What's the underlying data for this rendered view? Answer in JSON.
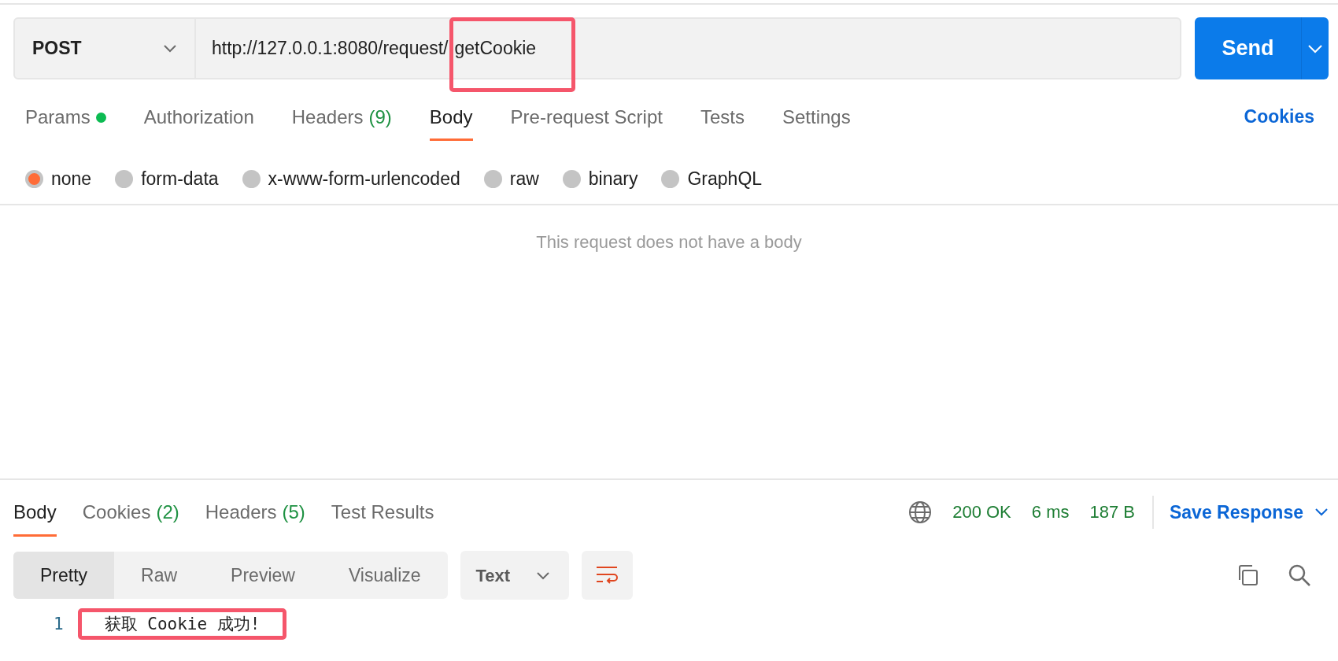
{
  "request": {
    "method": "POST",
    "url_parts": [
      {
        "text": "http://127.0.0.1:8080/request/",
        "highlighted": false
      },
      {
        "text": "getCookie",
        "highlighted": true
      }
    ],
    "send": "Send"
  },
  "request_tabs": [
    {
      "label": "Params",
      "dot": true,
      "selected": false
    },
    {
      "label": "Authorization",
      "selected": false
    },
    {
      "label": "Headers",
      "count": "(9)",
      "selected": false
    },
    {
      "label": "Body",
      "selected": true
    },
    {
      "label": "Pre-request Script",
      "selected": false
    },
    {
      "label": "Tests",
      "selected": false
    },
    {
      "label": "Settings",
      "selected": false
    }
  ],
  "cookies_link": "Cookies",
  "body_types": [
    {
      "label": "none",
      "selected": true
    },
    {
      "label": "form-data",
      "selected": false
    },
    {
      "label": "x-www-form-urlencoded",
      "selected": false
    },
    {
      "label": "raw",
      "selected": false
    },
    {
      "label": "binary",
      "selected": false
    },
    {
      "label": "GraphQL",
      "selected": false
    }
  ],
  "empty_message": "This request does not have a body",
  "response_tabs": [
    {
      "label": "Body",
      "selected": true
    },
    {
      "label": "Cookies",
      "count": "(2)",
      "selected": false
    },
    {
      "label": "Headers",
      "count": "(5)",
      "selected": false
    },
    {
      "label": "Test Results",
      "selected": false
    }
  ],
  "status": {
    "code": "200 OK",
    "time": "6 ms",
    "size": "187 B",
    "save": "Save Response"
  },
  "view_modes": [
    {
      "label": "Pretty",
      "selected": true
    },
    {
      "label": "Raw",
      "selected": false
    },
    {
      "label": "Preview",
      "selected": false
    },
    {
      "label": "Visualize",
      "selected": false
    }
  ],
  "format": "Text",
  "lines": [
    {
      "number": "1",
      "parts": [
        {
          "text": "获取 Cookie 成功!",
          "highlighted": true
        }
      ]
    }
  ]
}
